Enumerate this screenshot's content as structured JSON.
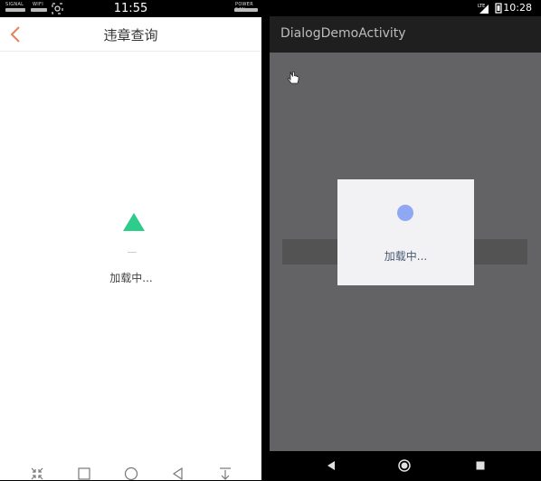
{
  "left_phone": {
    "status": {
      "signal_label": "SIGNAL",
      "wifi_label": "WIFI",
      "time": "11:55",
      "power_label": "POWER 54%"
    },
    "header": {
      "title": "违章查询",
      "back_icon": "chevron-left-icon",
      "accent_color": "#e8805a"
    },
    "loading": {
      "text": "加载中...",
      "indicator_color": "#2ecc8a"
    },
    "nav_icons": [
      "collapse-icon",
      "square-icon",
      "circle-icon",
      "triangle-back-icon",
      "download-icon"
    ]
  },
  "right_phone": {
    "status": {
      "time": "10:28",
      "network_label": "LTE"
    },
    "appbar": {
      "title": "DialogDemoActivity"
    },
    "dialog": {
      "loading_text": "加载中...",
      "dot_color": "#8ea8f3"
    },
    "nav_icons": [
      "back-triangle-icon",
      "home-circle-icon",
      "recents-square-icon"
    ]
  }
}
